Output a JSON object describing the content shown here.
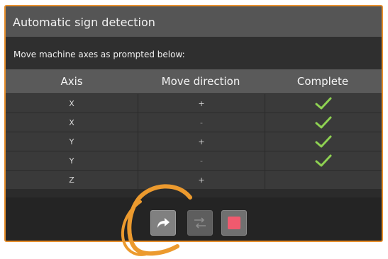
{
  "window": {
    "title": "Automatic sign detection"
  },
  "instruction": "Move machine axes as prompted below:",
  "table": {
    "headers": [
      "Axis",
      "Move direction",
      "Complete"
    ],
    "rows": [
      {
        "axis": "X",
        "direction": "+",
        "complete": true
      },
      {
        "axis": "X",
        "direction": "-",
        "complete": true
      },
      {
        "axis": "Y",
        "direction": "+",
        "complete": true
      },
      {
        "axis": "Y",
        "direction": "-",
        "complete": true
      },
      {
        "axis": "Z",
        "direction": "+",
        "complete": false
      }
    ]
  },
  "toolbar": {
    "buttons": [
      {
        "name": "next-button",
        "icon": "share-arrow-icon"
      },
      {
        "name": "swap-button",
        "icon": "swap-arrows-icon",
        "state": "disabled"
      },
      {
        "name": "stop-button",
        "icon": "stop-square-icon"
      }
    ]
  },
  "colors": {
    "accent_border": "#e8902e",
    "check": "#8ed152",
    "stop": "#f05a6e",
    "annotation": "#ec9a2e"
  }
}
